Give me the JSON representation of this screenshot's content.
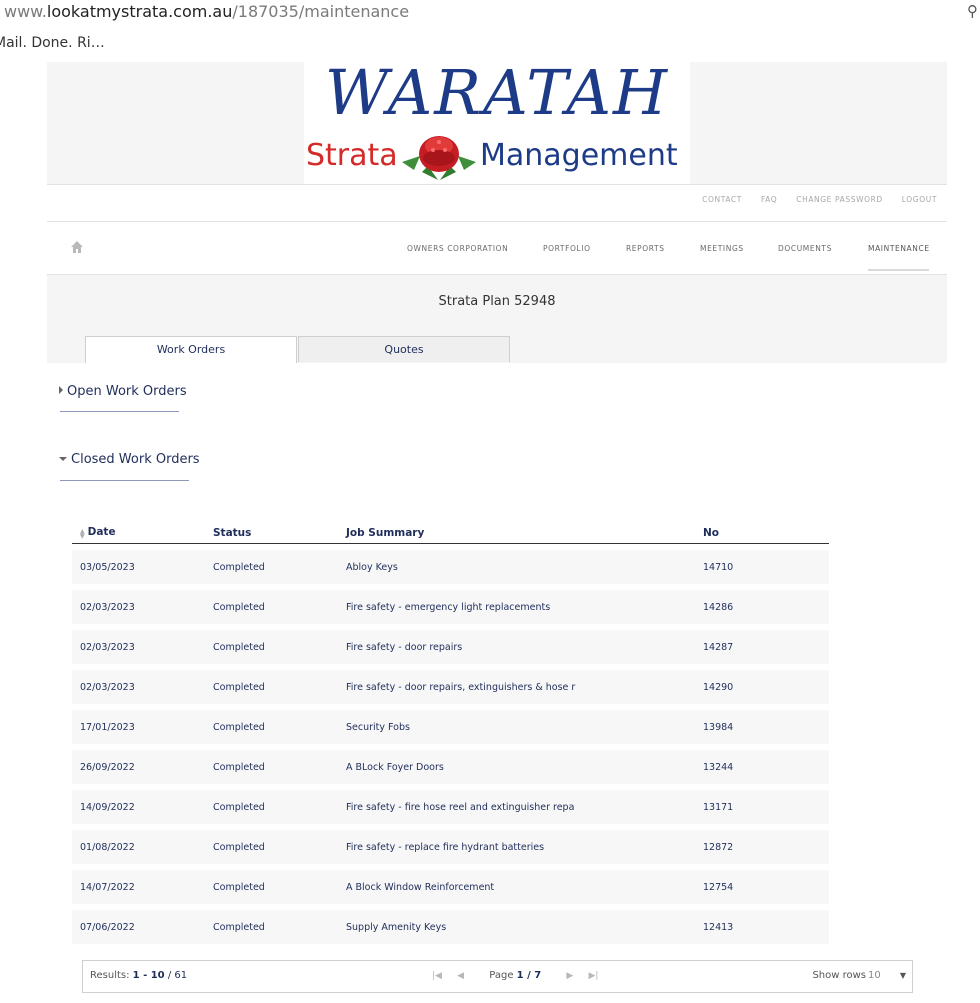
{
  "browser": {
    "url_prefix": "www.",
    "url_host": "lookatmystrata.com.au",
    "url_path": "/187035/maintenance",
    "tab_title": "Mail. Done. Ri…"
  },
  "logo": {
    "line1": "WARATAH",
    "left_word": "Strata",
    "right_word": "Management"
  },
  "top_menu": [
    "CONTACT",
    "FAQ",
    "CHANGE PASSWORD",
    "LOGOUT"
  ],
  "main_nav": {
    "items": [
      "OWNERS CORPORATION",
      "PORTFOLIO",
      "REPORTS",
      "MEETINGS",
      "DOCUMENTS",
      "MAINTENANCE"
    ],
    "active": "MAINTENANCE"
  },
  "plan_title": "Strata Plan 52948",
  "tabs": [
    "Work Orders",
    "Quotes"
  ],
  "sections": {
    "open": "Open Work Orders",
    "closed": "Closed Work Orders"
  },
  "table": {
    "headers": [
      "Date",
      "Status",
      "Job Summary",
      "No"
    ],
    "rows": [
      [
        "03/05/2023",
        "Completed",
        "Abloy Keys",
        "14710"
      ],
      [
        "02/03/2023",
        "Completed",
        "Fire safety - emergency light replacements",
        "14286"
      ],
      [
        "02/03/2023",
        "Completed",
        "Fire safety - door repairs",
        "14287"
      ],
      [
        "02/03/2023",
        "Completed",
        "Fire safety - door repairs, extinguishers & hose r",
        "14290"
      ],
      [
        "17/01/2023",
        "Completed",
        "Security Fobs",
        "13984"
      ],
      [
        "26/09/2022",
        "Completed",
        "A BLock Foyer Doors",
        "13244"
      ],
      [
        "14/09/2022",
        "Completed",
        "Fire safety - fire hose reel and extinguisher repa",
        "13171"
      ],
      [
        "01/08/2022",
        "Completed",
        "Fire safety - replace fire hydrant batteries",
        "12872"
      ],
      [
        "14/07/2022",
        "Completed",
        "A Block Window Reinforcement",
        "12754"
      ],
      [
        "07/06/2022",
        "Completed",
        "Supply Amenity Keys",
        "12413"
      ]
    ]
  },
  "footer": {
    "results_label": "Results: ",
    "results_range": "1 - 10",
    "results_total": " / 61",
    "page_label": "Page ",
    "page_value": "1 / 7",
    "show_rows_label": "Show rows",
    "rows_value": "10"
  },
  "colors": {
    "navy": "#1f2d5a",
    "brand_blue": "#1d3b86",
    "brand_red": "#d42a2a"
  }
}
